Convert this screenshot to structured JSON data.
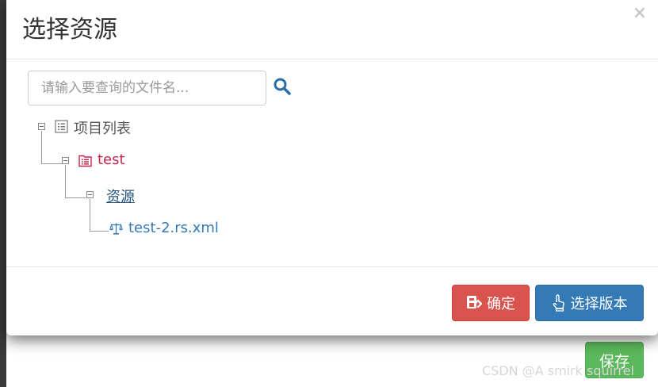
{
  "modal": {
    "title": "选择资源",
    "close_symbol": "×"
  },
  "search": {
    "placeholder": "请输入要查询的文件名...",
    "value": "",
    "icon": "search-icon"
  },
  "tree": {
    "root": {
      "label": "项目列表",
      "icon": "list-icon",
      "expanded": true,
      "color": "#555555"
    },
    "project": {
      "label": "test",
      "icon": "folder-list-icon",
      "expanded": true,
      "color": "#c7254e"
    },
    "folder": {
      "label": "资源",
      "icon": null,
      "expanded": true,
      "color": "#23527c",
      "selected": true
    },
    "file": {
      "label": "test-2.rs.xml",
      "icon": "scale-icon",
      "color": "#337ab7"
    }
  },
  "footer": {
    "confirm_label": "确定",
    "confirm_icon": "confirm-icon",
    "version_label": "选择版本",
    "version_icon": "hand-pointer-icon"
  },
  "background": {
    "save_label": "保存",
    "watermark": "CSDN @A smirk squirrel"
  },
  "colors": {
    "danger": "#d9534f",
    "primary": "#337ab7",
    "success": "#5cb85c"
  }
}
